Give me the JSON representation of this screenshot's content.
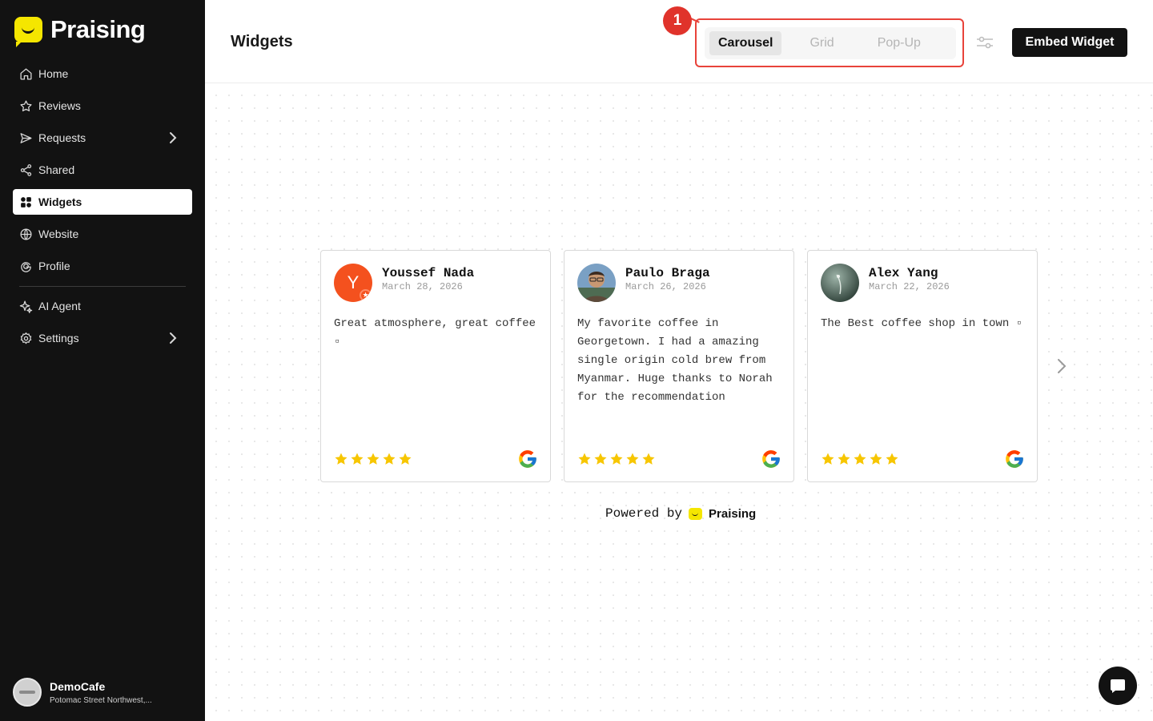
{
  "app": {
    "brand": "Praising"
  },
  "sidebar": {
    "items": [
      {
        "label": "Home",
        "icon": "home-icon"
      },
      {
        "label": "Reviews",
        "icon": "star-icon"
      },
      {
        "label": "Requests",
        "icon": "send-icon"
      },
      {
        "label": "Shared",
        "icon": "share-icon"
      },
      {
        "label": "Widgets",
        "icon": "widgets-icon",
        "active": true
      },
      {
        "label": "Website",
        "icon": "globe-icon"
      },
      {
        "label": "Profile",
        "icon": "google-g-icon"
      },
      {
        "label": "AI Agent",
        "icon": "sparkle-icon"
      },
      {
        "label": "Settings",
        "icon": "gear-icon"
      }
    ],
    "account": {
      "name": "DemoCafe",
      "address": "Potomac Street Northwest,..."
    }
  },
  "header": {
    "title": "Widgets",
    "annotation": "1",
    "tabs": [
      {
        "label": "Carousel",
        "active": true
      },
      {
        "label": "Grid",
        "active": false
      },
      {
        "label": "Pop-Up",
        "active": false
      }
    ],
    "embed_label": "Embed Widget"
  },
  "reviews": [
    {
      "name": "Youssef Nada",
      "date": "March 28, 2026",
      "text": "Great atmosphere, great coffee ▫",
      "avatar_letter": "Y",
      "rating": 5,
      "source": "google-icon"
    },
    {
      "name": "Paulo Braga",
      "date": "March 26, 2026",
      "text": "My favorite coffee in Georgetown. I had a amazing single origin cold brew from Myanmar. Huge thanks to Norah for the recommendation",
      "rating": 5,
      "source": "google-icon"
    },
    {
      "name": "Alex Yang",
      "date": "March 22, 2026",
      "text": "The Best coffee shop in town ▫",
      "rating": 5,
      "source": "google-icon"
    }
  ],
  "powered": {
    "prefix": "Powered by",
    "brand": "Praising"
  },
  "colors": {
    "brand_yellow": "#f5e600",
    "sidebar_bg": "#121212",
    "annotation_red": "#e8433a",
    "star": "#f7c600"
  }
}
